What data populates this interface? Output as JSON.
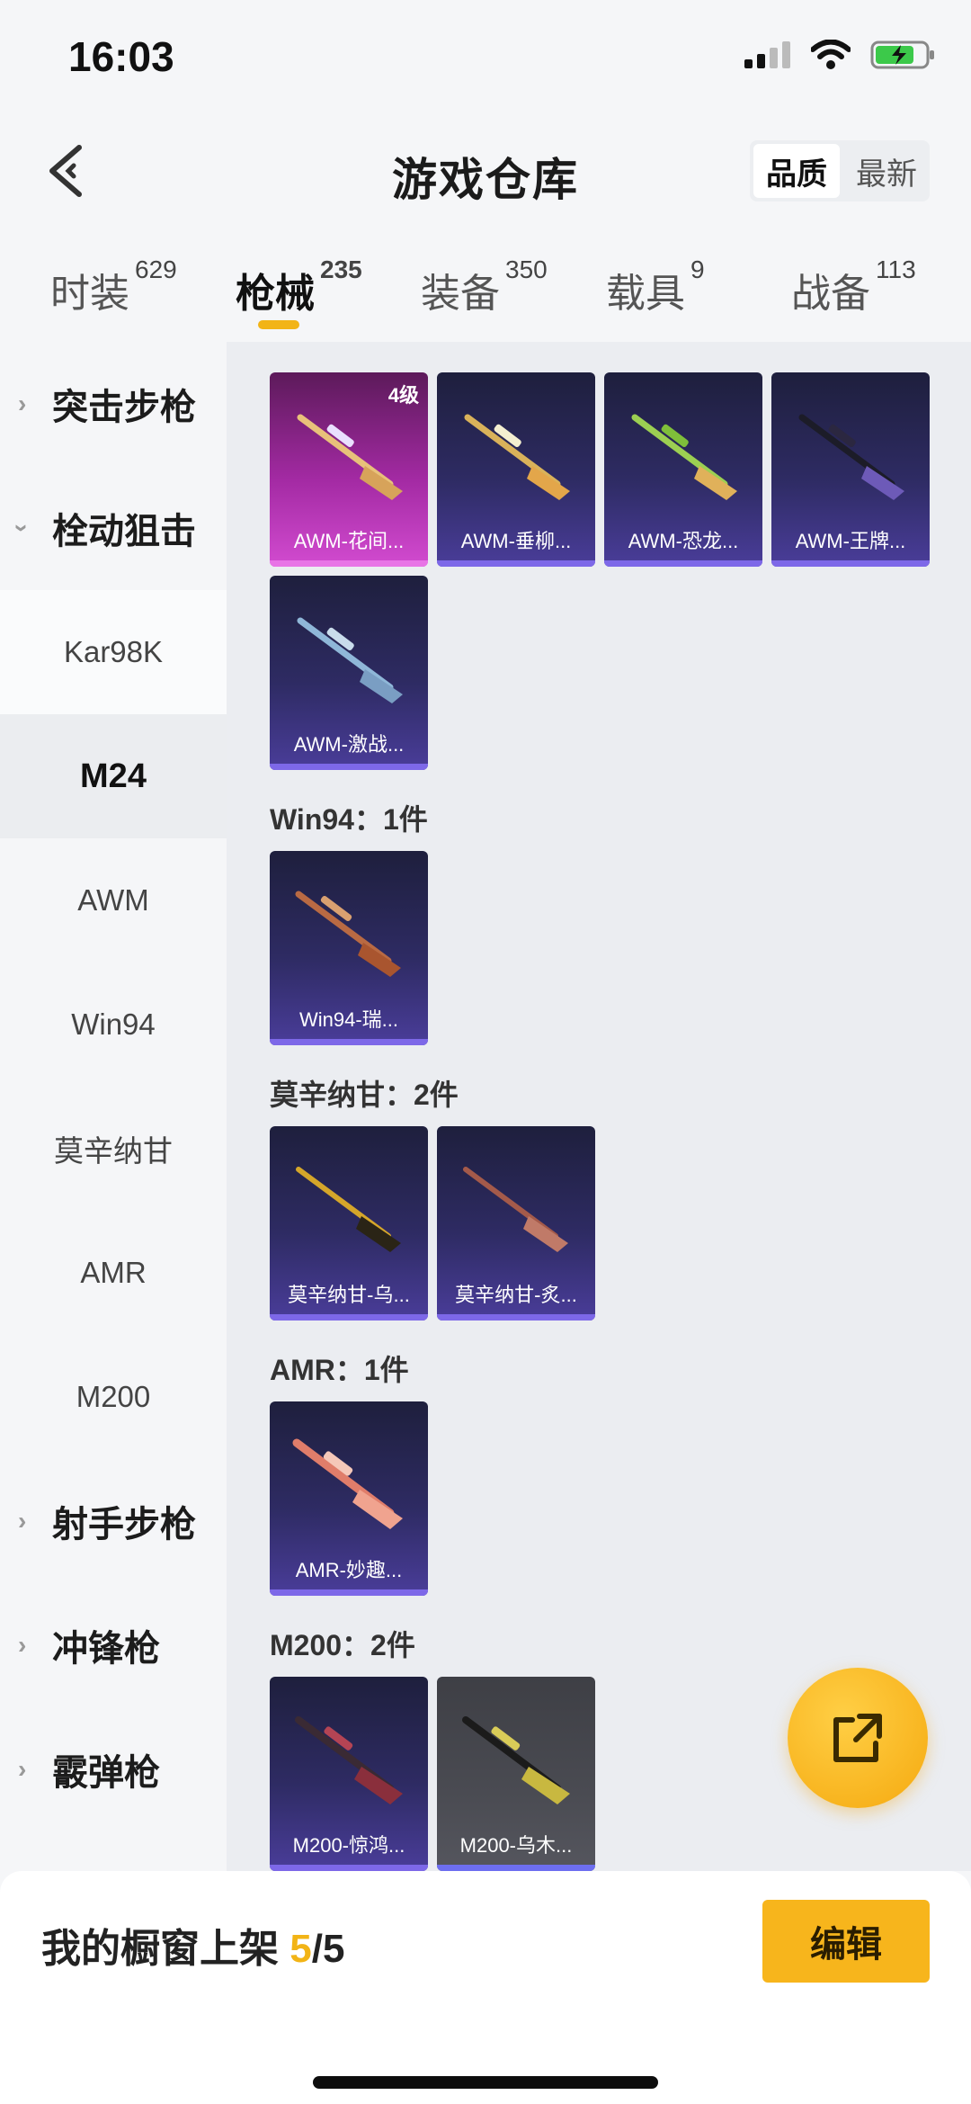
{
  "status": {
    "time": "16:03"
  },
  "header": {
    "title": "游戏仓库",
    "sort_quality": "品质",
    "sort_latest": "最新"
  },
  "tabs": [
    {
      "label": "时装",
      "count": "629"
    },
    {
      "label": "枪械",
      "count": "235"
    },
    {
      "label": "装备",
      "count": "350"
    },
    {
      "label": "载具",
      "count": "9"
    },
    {
      "label": "战备",
      "count": "113"
    }
  ],
  "sidebar": {
    "assault_rifle": "突击步枪",
    "bolt_sniper": "栓动狙击",
    "kar98k": "Kar98K",
    "m24": "M24",
    "awm": "AWM",
    "win94": "Win94",
    "mosin": "莫辛纳甘",
    "amr": "AMR",
    "m200": "M200",
    "marksman": "射手步枪",
    "smg": "冲锋枪",
    "shotgun": "霰弹枪"
  },
  "sections": {
    "win94": "Win94：1件",
    "mosin": "莫辛纳甘：2件",
    "amr": "AMR：1件",
    "m200": "M200：2件"
  },
  "cards": {
    "awm1": {
      "label": "AWM-花间...",
      "badge": "4级"
    },
    "awm2": {
      "label": "AWM-垂柳..."
    },
    "awm3": {
      "label": "AWM-恐龙..."
    },
    "awm4": {
      "label": "AWM-王牌..."
    },
    "awm5": {
      "label": "AWM-激战..."
    },
    "win94_1": {
      "label": "Win94-瑞..."
    },
    "mosin1": {
      "label": "莫辛纳甘-乌..."
    },
    "mosin2": {
      "label": "莫辛纳甘-炙..."
    },
    "amr1": {
      "label": "AMR-妙趣..."
    },
    "m200_1": {
      "label": "M200-惊鸿..."
    },
    "m200_2": {
      "label": "M200-乌木..."
    }
  },
  "bottom": {
    "showcase_label": "我的橱窗上架",
    "showcase_current": "5",
    "showcase_total": "/5",
    "edit_label": "编辑"
  },
  "colors": {
    "accent": "#f2b416",
    "card_purple": "#2e2b63",
    "card_pink": "#a32aa3"
  }
}
